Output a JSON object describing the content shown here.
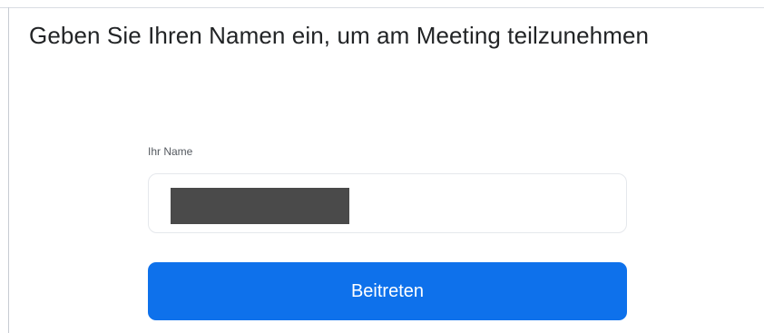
{
  "dialog": {
    "title": "Geben Sie Ihren Namen ein, um am Meeting teilzunehmen",
    "name_label": "Ihr Name",
    "name_value": "",
    "join_label": "Beitreten"
  },
  "colors": {
    "primary_button": "#0e71eb",
    "redaction": "#4a4a4a"
  }
}
